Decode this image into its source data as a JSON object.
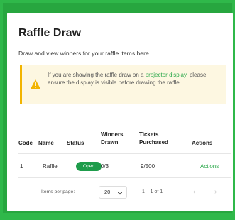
{
  "header": {
    "title": "Raffle Draw",
    "subtitle": "Draw and view winners for your raffle items here."
  },
  "warning": {
    "text_before": "If you are showing the raffle draw on a ",
    "link_text": "projector display",
    "text_after": ", please ensure the display is visible before drawing the raffle.",
    "icon": "warning-triangle-icon",
    "accent_color": "#f2b400"
  },
  "table": {
    "columns": [
      "Code",
      "Name",
      "Status",
      "Winners Drawn",
      "Tickets Purchased",
      "Actions"
    ],
    "rows": [
      {
        "code": "1",
        "name": "Raffle",
        "status": "Open",
        "winners_drawn": "0/3",
        "tickets_purchased": "9/500",
        "actions": "Actions"
      }
    ]
  },
  "pagination": {
    "items_per_page_label": "Items per page:",
    "items_per_page_value": "20",
    "range": "1 – 1 of 1",
    "prev_icon": "chevron-left-icon",
    "next_icon": "chevron-right-icon"
  },
  "colors": {
    "background_green": "#2fb84a",
    "status_open": "#1e9c4b",
    "link_green": "#2aa84a"
  }
}
